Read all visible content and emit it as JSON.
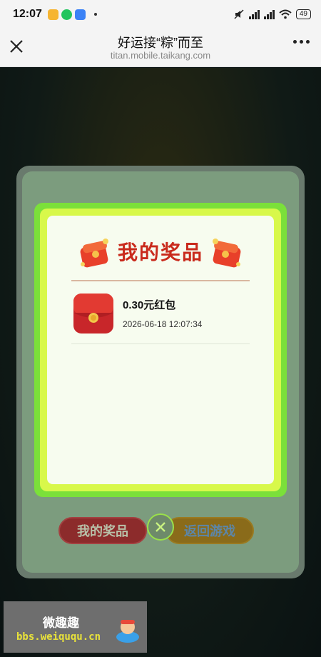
{
  "status_bar": {
    "time": "12:07",
    "battery": "49",
    "app_icons": [
      "notes-app-icon",
      "wechat-icon",
      "game-app-icon"
    ]
  },
  "nav": {
    "title": "好运接“粽”而至",
    "url": "titan.mobile.taikang.com"
  },
  "modal": {
    "title": "我的奖品",
    "prizes": [
      {
        "name": "0.30元红包",
        "time": "2026-06-18 12:07:34",
        "icon": "red-envelope-icon"
      }
    ]
  },
  "buttons": {
    "my_prizes": "我的奖品",
    "back_to_game": "返回游戏"
  },
  "watermark": {
    "title": "微趣趣",
    "url": "bbs.weiququ.cn"
  },
  "colors": {
    "title_red": "#c92a1c",
    "card_green": "#7be03a",
    "card_yellow": "#d8f84a",
    "card_bg": "#f7fcef"
  }
}
